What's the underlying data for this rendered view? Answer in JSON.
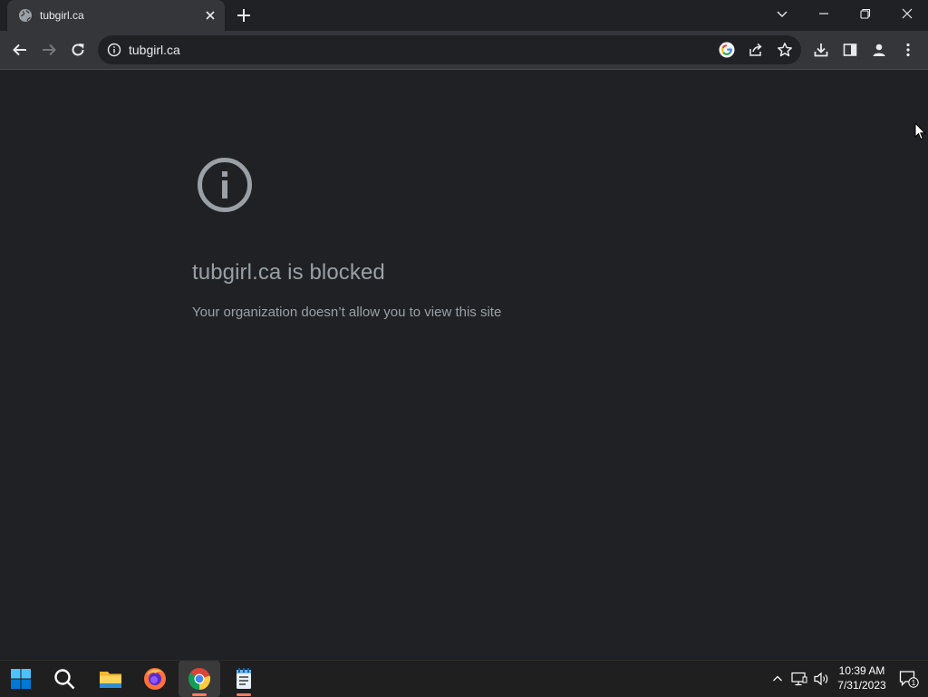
{
  "browser": {
    "tab": {
      "title": "tubgirl.ca"
    },
    "address_bar": {
      "url": "tubgirl.ca"
    }
  },
  "page": {
    "heading": "tubgirl.ca is blocked",
    "message": "Your organization doesn’t allow you to view this site"
  },
  "taskbar": {
    "apps": [
      "start-icon",
      "search-icon",
      "file-explorer-icon",
      "firefox-icon",
      "chrome-icon",
      "notepad-icon"
    ],
    "clock": {
      "time": "10:39 AM",
      "date": "7/31/2023"
    },
    "notification_count": "1"
  },
  "colors": {
    "background": "#202124",
    "toolbar": "#35363a",
    "text_muted": "#9aa0a6",
    "windows_blue": "#0078d4"
  }
}
